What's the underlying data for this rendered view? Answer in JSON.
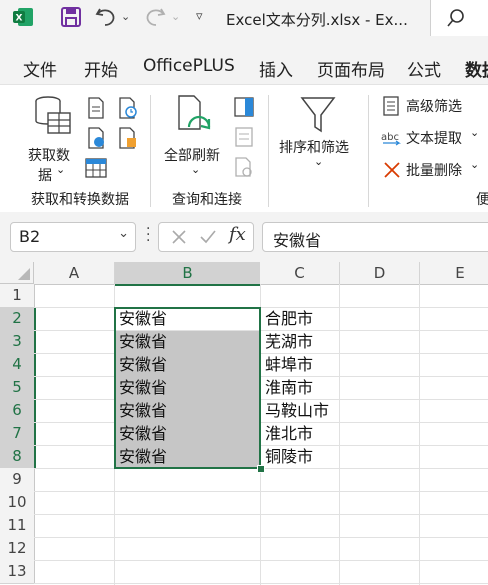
{
  "app": {
    "title": "Excel文本分列.xlsx  -  Ex...",
    "logo": "X"
  },
  "tabs": [
    "文件",
    "开始",
    "OfficePLUS",
    "插入",
    "页面布局",
    "公式",
    "数据"
  ],
  "ribbon": {
    "get_data_label_1": "获取数",
    "get_data_label_2": "据",
    "group1": "获取和转换数据",
    "refresh_all_label": "全部刷新",
    "group2": "查询和连接",
    "sort_filter_label": "排序和筛选",
    "advanced_filter": "高级筛选",
    "text_extract": "文本提取",
    "batch_delete": "批量删除",
    "group_partial": "便"
  },
  "formula_bar": {
    "name_box": "B2",
    "content": "安徽省"
  },
  "columns": [
    "A",
    "B",
    "C",
    "D",
    "E"
  ],
  "rows": [
    "1",
    "2",
    "3",
    "4",
    "5",
    "6",
    "7",
    "8",
    "9",
    "10",
    "11",
    "12",
    "13"
  ],
  "col_b": [
    "安徽省",
    "安徽省",
    "安徽省",
    "安徽省",
    "安徽省",
    "安徽省",
    "安徽省"
  ],
  "col_c": [
    "合肥市",
    "芜湖市",
    "蚌埠市",
    "淮南市",
    "马鞍山市",
    "淮北市",
    "铜陵市"
  ],
  "colors": {
    "accent": "#217346",
    "selection": "#c6c6c6",
    "header_bg": "#f3f3f3"
  }
}
